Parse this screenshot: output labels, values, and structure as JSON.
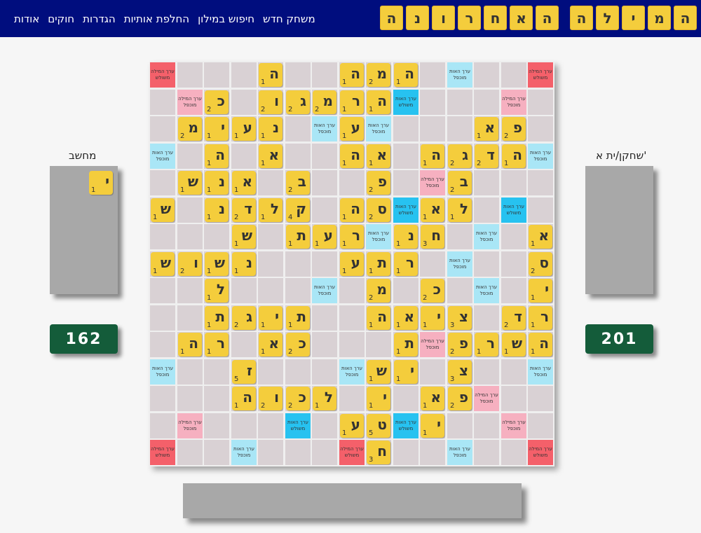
{
  "nav": {
    "items": [
      "אודות",
      "חוקים",
      "הגדרות",
      "החלפת אותיות",
      "חיפוש במילון",
      "משחק חדש"
    ]
  },
  "title": {
    "word1": [
      "ה",
      "מ",
      "י",
      "ל",
      "ה"
    ],
    "word2": [
      "ה",
      "א",
      "ח",
      "ר",
      "ו",
      "נ",
      "ה"
    ]
  },
  "players": {
    "human": {
      "name": "שחקן/ית א'",
      "score": "201"
    },
    "computer": {
      "name": "מחשב",
      "score": "162"
    }
  },
  "computer_rack": [
    {
      "letter": "י",
      "value": "1"
    }
  ],
  "premium_labels": {
    "TW": "ערך המילה משולש",
    "DW": "ערך המילה מוכפל",
    "TL": "ערך האות משולש",
    "DL": "ערך האות מוכפל"
  },
  "board": {
    "size": 15,
    "premiums": [
      [
        "TW",
        "",
        "",
        "DL",
        "",
        "",
        "",
        "",
        "",
        "",
        "",
        "",
        "",
        "",
        "TW"
      ],
      [
        "",
        "DW",
        "",
        "",
        "",
        "TL",
        "",
        "",
        "",
        "",
        "",
        "",
        "",
        "DW",
        ""
      ],
      [
        "",
        "",
        "",
        "",
        "",
        "",
        "DL",
        "",
        "DL",
        "",
        "",
        "",
        "",
        "",
        ""
      ],
      [
        "DL",
        "",
        "",
        "",
        "",
        "",
        "",
        "",
        "",
        "",
        "",
        "",
        "",
        "",
        "DL"
      ],
      [
        "",
        "",
        "",
        "",
        "DW",
        "",
        "",
        "",
        "",
        "",
        "",
        "",
        "",
        "",
        ""
      ],
      [
        "",
        "TL",
        "",
        "",
        "",
        "TL",
        "",
        "",
        "",
        "",
        "",
        "",
        "TL",
        "",
        ""
      ],
      [
        "",
        "",
        "DL",
        "",
        "",
        "",
        "DL",
        "",
        "",
        "",
        "",
        "DL",
        "",
        "",
        ""
      ],
      [
        "",
        "",
        "",
        "DL",
        "",
        "",
        "",
        "",
        "",
        "",
        "",
        "",
        "",
        "",
        ""
      ],
      [
        "",
        "",
        "DL",
        "",
        "",
        "",
        "",
        "",
        "DL",
        "",
        "",
        "",
        "",
        "",
        ""
      ],
      [
        "",
        "",
        "",
        "",
        "",
        "",
        "",
        "",
        "",
        "TL",
        "",
        "",
        "",
        "",
        ""
      ],
      [
        "",
        "",
        "",
        "",
        "DW",
        "",
        "",
        "",
        "",
        "",
        "",
        "",
        "",
        "",
        ""
      ],
      [
        "DL",
        "",
        "",
        "",
        "",
        "",
        "",
        "DL",
        "",
        "",
        "",
        "",
        "",
        "",
        "DL"
      ],
      [
        "",
        "",
        "DW",
        "",
        "",
        "",
        "",
        "",
        "",
        "",
        "",
        "DW",
        "",
        "",
        ""
      ],
      [
        "",
        "DW",
        "",
        "",
        "",
        "TL",
        "",
        "",
        "",
        "TL",
        "",
        "",
        "",
        "DW",
        ""
      ],
      [
        "TW",
        "",
        "",
        "DL",
        "",
        "",
        "",
        "TW",
        "",
        "",
        "",
        "DL",
        "",
        "",
        "TW"
      ]
    ],
    "tiles": [
      [
        "",
        "",
        "",
        "",
        "",
        "ה:1",
        "מ:2",
        "ה:1",
        "",
        "",
        "ה:1",
        "",
        "",
        "",
        ""
      ],
      [
        "",
        "",
        "",
        "",
        "",
        "",
        "ה:1",
        "ר:1",
        "מ:2",
        "ג:2",
        "ו:2",
        "",
        "כ:2",
        "",
        ""
      ],
      [
        "",
        "פ:2",
        "א:1",
        "",
        "",
        "",
        "",
        "ע:1",
        "",
        "",
        "נ:1",
        "ע:1",
        "י:1",
        "מ:2",
        ""
      ],
      [
        "",
        "ה:1",
        "ד:2",
        "ג:2",
        "ה:1",
        "",
        "א:1",
        "ה:1",
        "",
        "",
        "א:1",
        "",
        "ה:1",
        "",
        ""
      ],
      [
        "",
        "",
        "",
        "ב:2",
        "",
        "",
        "פ:2",
        "",
        "",
        "ב:2",
        "",
        "א:1",
        "נ:1",
        "ש:1",
        ""
      ],
      [
        "",
        "",
        "",
        "ל:1",
        "א:1",
        "",
        "ס:2",
        "ה:1",
        "",
        "ק:4",
        "ל:1",
        "ד:2",
        "נ:1",
        "",
        "ש:1"
      ],
      [
        "א:1",
        "",
        "",
        "",
        "ח:3",
        "נ:1",
        "",
        "ר:1",
        "ע:1",
        "ת:1",
        "",
        "ש:1",
        "",
        "",
        ""
      ],
      [
        "ס:2",
        "",
        "",
        "",
        "",
        "ר:1",
        "ת:1",
        "ע:1",
        "",
        "",
        "",
        "נ:1",
        "ש:1",
        "ו:2",
        "ש:1"
      ],
      [
        "י:1",
        "",
        "",
        "",
        "כ:2",
        "",
        "מ:2",
        "",
        "",
        "",
        "",
        "",
        "ל:1",
        "",
        ""
      ],
      [
        "ר:1",
        "ד:2",
        "",
        "צ:3",
        "י:1",
        "א:1",
        "ה:1",
        "",
        "",
        "ת:1",
        "י:1",
        "ג:2",
        "ת:1",
        "",
        ""
      ],
      [
        "ה:1",
        "ש:1",
        "ר:1",
        "פ:2",
        "",
        "ת:1",
        "",
        "",
        "",
        "כ:2",
        "א:1",
        "",
        "ר:1",
        "ה:1",
        ""
      ],
      [
        "",
        "",
        "",
        "צ:3",
        "",
        "י:1",
        "ש:1",
        "",
        "",
        "",
        "",
        "ז:5",
        "",
        "",
        ""
      ],
      [
        "",
        "",
        "",
        "פ:2",
        "א:1",
        "",
        "י:1",
        "",
        "ל:1",
        "כ:2",
        "ו:2",
        "ה:1",
        "",
        "",
        ""
      ],
      [
        "",
        "",
        "",
        "",
        "י:1",
        "",
        "ט:5",
        "ע:1",
        "",
        "",
        "",
        "",
        "",
        "",
        ""
      ],
      [
        "",
        "",
        "",
        "",
        "",
        "",
        "ח:3",
        "",
        "",
        "",
        "",
        "",
        "",
        "",
        ""
      ]
    ]
  }
}
